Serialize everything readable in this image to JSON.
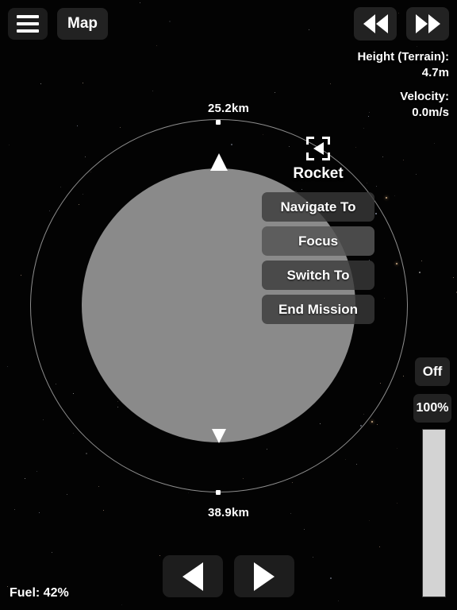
{
  "app": {
    "background_color": "#030303",
    "planet_color": "#8a8a8a",
    "orbit_color": "#8d8d8d",
    "accent_color": "#d3d3d3"
  },
  "topbar": {
    "menu_icon": "hamburger-menu-icon",
    "map_label": "Map"
  },
  "timewarp": {
    "rewind_icon": "rewind-icon",
    "fastforward_icon": "fast-forward-icon"
  },
  "telemetry": {
    "height_label": "Height (Terrain):",
    "height_value": "4.7m",
    "velocity_label": "Velocity:",
    "velocity_value": "0.0m/s"
  },
  "map": {
    "apoapsis_label": "25.2km",
    "periapsis_label": "38.9km",
    "apoapsis_node_icon": "orbit-node-icon",
    "periapsis_node_icon": "orbit-node-icon",
    "marker_up_icon": "craft-marker-up-icon",
    "marker_down_icon": "craft-marker-down-icon",
    "planet_name": ""
  },
  "selection": {
    "reticle_icon": "selection-reticle-icon",
    "craft_icon": "rocket-craft-icon",
    "craft_name": "Rocket",
    "menu_items": [
      {
        "label": "Navigate To",
        "active": false
      },
      {
        "label": "Focus",
        "active": true
      },
      {
        "label": "Switch To",
        "active": false
      },
      {
        "label": "End Mission",
        "active": false
      }
    ]
  },
  "controls": {
    "rcs_label": "Off",
    "throttle_label": "100%",
    "throttle_percent": 100,
    "rotate_left_icon": "rotate-left-icon",
    "rotate_right_icon": "rotate-right-icon"
  },
  "status": {
    "fuel_label": "Fuel: 42%"
  }
}
